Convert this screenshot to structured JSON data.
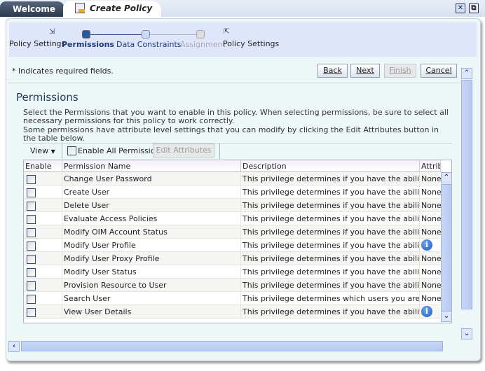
{
  "tabs": {
    "welcome": "Welcome",
    "create_policy": "Create Policy"
  },
  "train": {
    "stops": [
      {
        "label": "Policy Settings",
        "state": "visited"
      },
      {
        "label": "Permissions",
        "state": "current"
      },
      {
        "label": "Data Constraints",
        "state": "next"
      },
      {
        "label": "Assignment",
        "state": "disabled"
      },
      {
        "label": "Policy Settings",
        "state": "visited"
      }
    ]
  },
  "required_note": "* Indicates required fields.",
  "buttons": {
    "back": "Back",
    "next": "Next",
    "finish": "Finish",
    "cancel": "Cancel"
  },
  "section": {
    "title": "Permissions",
    "desc1": "Select the Permissions that you want to enable in this policy. When selecting permissions, be sure to select all necessary permissions for this policy to work correctly.",
    "desc2": "Some permissions have attribute level settings that you can modify by clicking the Edit Attributes button in the table below."
  },
  "toolbar": {
    "view": "View",
    "enable_all": "Enable All Permissions",
    "edit_attributes": "Edit Attributes"
  },
  "table": {
    "headers": {
      "enable": "Enable",
      "name": "Permission Name",
      "description": "Description",
      "attributes": "Attrib"
    },
    "rows": [
      {
        "name": "Change User Password",
        "description": "This privilege determines if you have the ability to ch",
        "attr": "None"
      },
      {
        "name": "Create User",
        "description": "This privilege determines if you have the ability to cre",
        "attr": "None"
      },
      {
        "name": "Delete User",
        "description": "This privilege determines if you have the ability to de",
        "attr": "None"
      },
      {
        "name": "Evaluate Access Policies",
        "description": "This privilege determines if you have the ability to ini",
        "attr": "None"
      },
      {
        "name": "Modify OIM Account Status",
        "description": "This privilege determines if you have the ability to loc",
        "attr": "None"
      },
      {
        "name": "Modify User Profile",
        "description": "This privilege determines if you have the ability to mo",
        "attr": "info"
      },
      {
        "name": "Modify User Proxy Profile",
        "description": "This privilege determines if you have the ability to mo",
        "attr": "None"
      },
      {
        "name": "Modify User Status",
        "description": "This privilege determines if you have the ability to en",
        "attr": "None"
      },
      {
        "name": "Provision Resource to User",
        "description": "This privilege determines if you have the ability to pr",
        "attr": "None"
      },
      {
        "name": "Search User",
        "description": "This privilege determines which users you are allowed",
        "attr": "None"
      },
      {
        "name": "View User Details",
        "description": "This privilege determines if you have the ability to dis",
        "attr": "info"
      }
    ]
  }
}
